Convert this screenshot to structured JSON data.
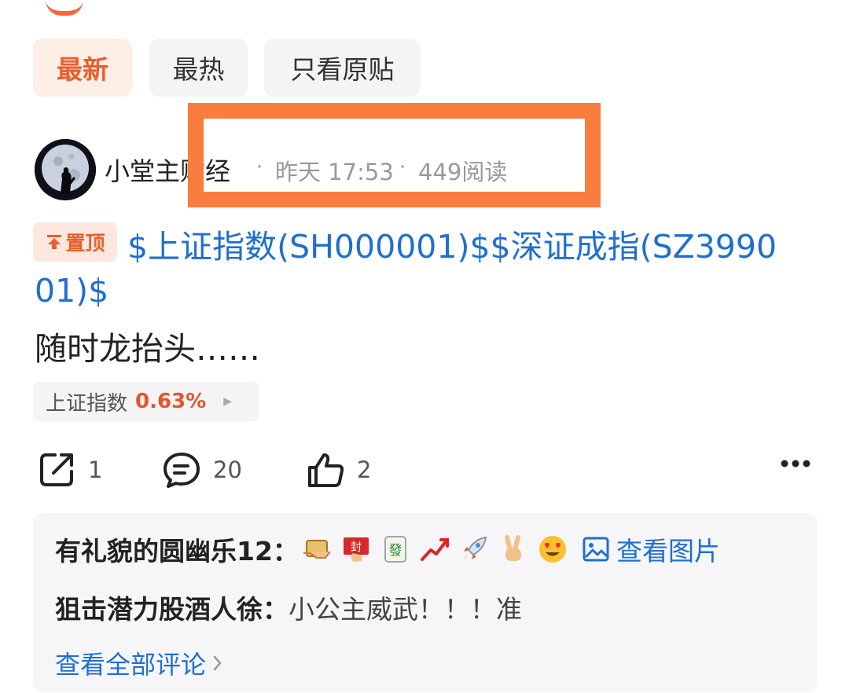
{
  "filters": {
    "latest": "最新",
    "hottest": "最热",
    "op_only": "只看原贴"
  },
  "post": {
    "author": "小堂主财经",
    "sep": "·",
    "time": "昨天 17:53",
    "reads": "449阅读",
    "pin_label": "置顶",
    "title_line1": "$上证指数(SH000001)$$深证成指(SZ3990",
    "title_line2": "01)$",
    "body": "随时龙抬头……",
    "index_chip": {
      "name": "上证指数",
      "change": "0.63%"
    },
    "actions": {
      "share_count": "1",
      "comment_count": "20",
      "like_count": "2"
    }
  },
  "comments": {
    "c1": {
      "author": "有礼貌的圆幽乐12：",
      "emojis": [
        "money-bag-emoji",
        "fortune-envelope-emoji",
        "mahjong-fa-emoji",
        "rising-chart-emoji",
        "rocket-emoji",
        "victory-hand-emoji",
        "heart-eyes-emoji"
      ],
      "view_image": "查看图片"
    },
    "c2": {
      "author": "狙击潜力股酒人徐：",
      "text": "小公主威武！！！准"
    },
    "view_all": "查看全部评论"
  },
  "colors": {
    "accent": "#e8602c",
    "link": "#1f6fd0",
    "highlight": "#f97d3f",
    "gain": "#e2572b"
  }
}
